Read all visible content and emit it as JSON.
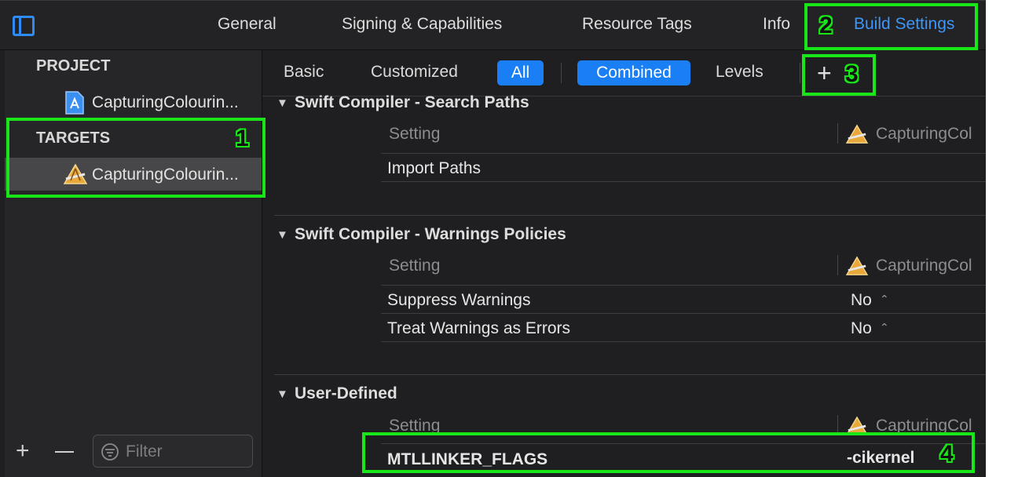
{
  "header": {
    "tabs": [
      {
        "label": "General"
      },
      {
        "label": "Signing & Capabilities"
      },
      {
        "label": "Resource Tags"
      },
      {
        "label": "Info"
      },
      {
        "label": "Build Settings"
      }
    ]
  },
  "sidebar": {
    "project_heading": "PROJECT",
    "project_item": "CapturingColourin...",
    "targets_heading": "TARGETS",
    "target_item": "CapturingColourin...",
    "filter_placeholder": "Filter"
  },
  "scope_bar": {
    "basic": "Basic",
    "customized": "Customized",
    "all": "All",
    "combined": "Combined",
    "levels": "Levels",
    "add": "+"
  },
  "groups": [
    {
      "title": "Swift Compiler - Search Paths",
      "column_setting": "Setting",
      "column_target": "CapturingCol",
      "rows": [
        {
          "name": "Import Paths",
          "value": ""
        }
      ]
    },
    {
      "title": "Swift Compiler - Warnings Policies",
      "column_setting": "Setting",
      "column_target": "CapturingCol",
      "rows": [
        {
          "name": "Suppress Warnings",
          "value": "No"
        },
        {
          "name": "Treat Warnings as Errors",
          "value": "No"
        }
      ]
    },
    {
      "title": "User-Defined",
      "column_setting": "Setting",
      "column_target": "CapturingCol",
      "rows": [
        {
          "name": "MTLLINKER_FLAGS",
          "value": "-cikernel"
        }
      ]
    }
  ],
  "annotations": [
    "1",
    "2",
    "3",
    "4"
  ],
  "colors": {
    "accent": "#2f8cf7",
    "highlight": "#19e619",
    "background": "#1f1f21"
  }
}
